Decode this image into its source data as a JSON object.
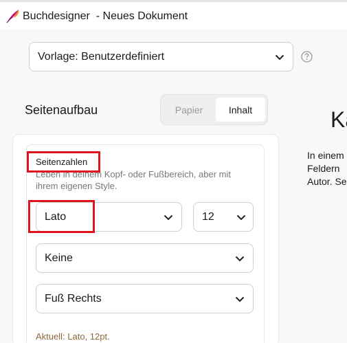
{
  "app": {
    "title": "Buchdesigner  - Neues Dokument"
  },
  "template": {
    "value": "Vorlage: Benutzerdefiniert",
    "help_icon": "question-circle-icon"
  },
  "layout": {
    "heading": "Seitenaufbau",
    "tabs": [
      {
        "label": "Papier",
        "active": false
      },
      {
        "label": "Inhalt",
        "active": true
      }
    ]
  },
  "page_numbers": {
    "title": "Seitenzahlen",
    "description": "Leben in deinem Kopf- oder Fußbereich, aber mit\nihrem eigenen Style.",
    "font": "Lato",
    "size": "12",
    "style": "Keine",
    "position": "Fuß Rechts",
    "current": "Aktuell: Lato, 12pt."
  },
  "preview": {
    "heading": "Ka",
    "text": "In einem\nFeldern \nAutor. Se"
  },
  "colors": {
    "highlight": "#e0141e",
    "accent_text": "#8a6a3a"
  }
}
